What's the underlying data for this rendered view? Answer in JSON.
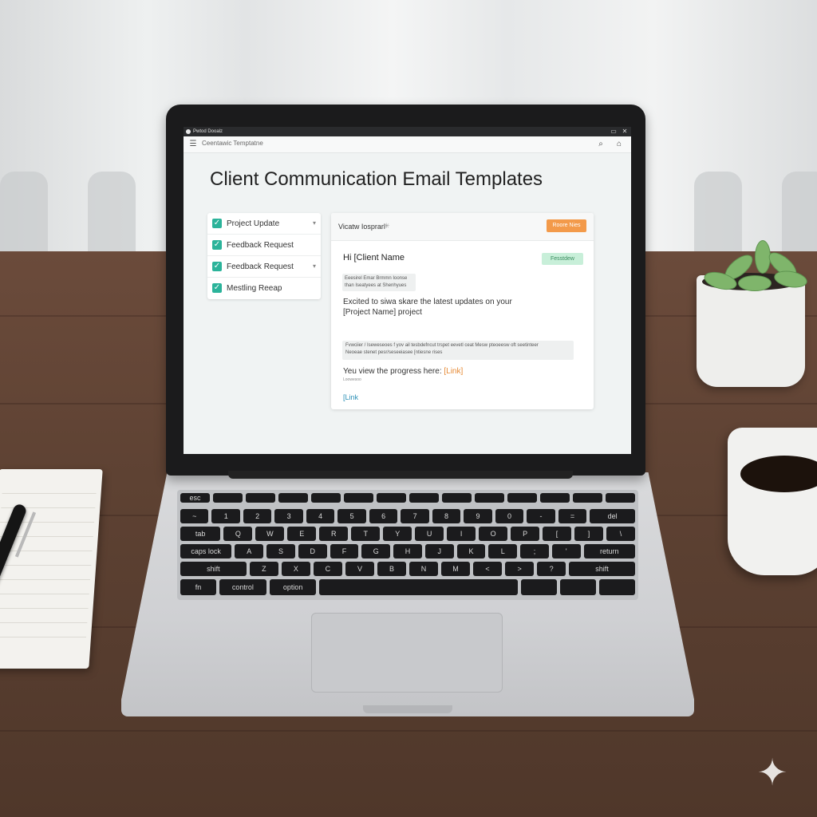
{
  "window": {
    "title": "Pwtod Dooalz",
    "controls": [
      "▭",
      "✕"
    ]
  },
  "toolbar": {
    "menu_icon": "☰",
    "breadcrumb": "Ceentawic Temptatne",
    "search_icon": "⌕",
    "settings_icon": "⌂"
  },
  "page": {
    "title": "Client Communication Email Templates"
  },
  "templates": [
    {
      "label": "Project Update",
      "checked": true,
      "has_chevron": true
    },
    {
      "label": "Feedback Request",
      "checked": true,
      "has_chevron": false
    },
    {
      "label": "Feedback Request",
      "checked": true,
      "has_chevron": true
    },
    {
      "label": "Mestling Reeap",
      "checked": true,
      "has_chevron": false
    }
  ],
  "editor": {
    "title": "Vicatw Iosprarl",
    "title_icon": "✳",
    "action_button": "Roore Nies",
    "status_badge": "Fesstdew",
    "greeting": "Hi [Client Name",
    "meta_line1": "Eeesirel Emar Brmmn Ioonse",
    "meta_line2": "than Iseatyees at Shenhyues",
    "body_line1": "Excited to siwa skare the latest updates on your",
    "body_line2": "[Project Name] project",
    "para_line1": "Fvwciier / Iseweseoes f yov ail tesbdefncut trspet eevetl ceat Mesw pteoeesw oft seetinteer",
    "para_line2": "Neoeae stenet pesr/seseeiasee [ntiesne rises",
    "progress_text": "Yeu view the progress here: ",
    "progress_link": "[Link]",
    "tiny_text": "Loowesoo",
    "link2": "[Link"
  },
  "keyboard": {
    "row0": [
      "esc",
      "",
      "",
      "",
      "",
      "",
      "",
      "",
      "",
      "",
      "",
      "",
      "",
      ""
    ],
    "row1": [
      "~",
      "1",
      "2",
      "3",
      "4",
      "5",
      "6",
      "7",
      "8",
      "9",
      "0",
      "-",
      "=",
      "del"
    ],
    "row2": [
      "tab",
      "Q",
      "W",
      "E",
      "R",
      "T",
      "Y",
      "U",
      "I",
      "O",
      "P",
      "[",
      "]",
      "\\"
    ],
    "row3": [
      "caps lock",
      "A",
      "S",
      "D",
      "F",
      "G",
      "H",
      "J",
      "K",
      "L",
      ";",
      "'",
      "return"
    ],
    "row4": [
      "shift",
      "Z",
      "X",
      "C",
      "V",
      "B",
      "N",
      "M",
      "<",
      ">",
      "?",
      "shift"
    ],
    "row5": [
      "fn",
      "control",
      "option",
      "",
      "",
      "",
      ""
    ]
  },
  "decor": {
    "sparkle": "✦"
  },
  "colors": {
    "accent_teal": "#2bb39a",
    "accent_orange": "#f39a4a",
    "badge_green_bg": "#c8efd9",
    "link_blue": "#2a8fb5"
  }
}
